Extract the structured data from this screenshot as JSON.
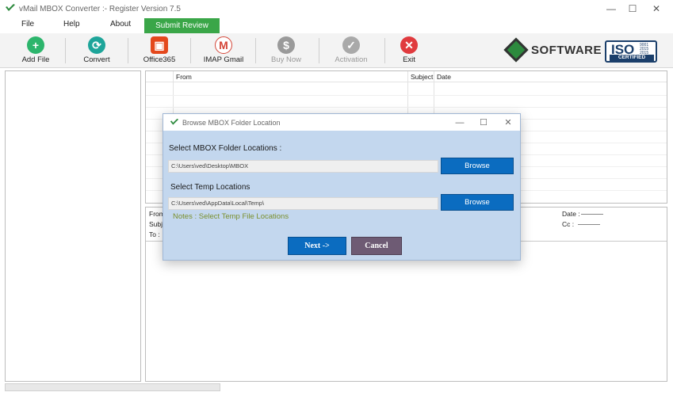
{
  "window": {
    "title": "vMail MBOX Converter :- Register Version 7.5",
    "controls": {
      "minimize": "—",
      "maximize": "☐",
      "close": "✕"
    }
  },
  "menu": {
    "file": "File",
    "help": "Help",
    "about": "About",
    "submit_review": "Submit Review"
  },
  "toolbar": {
    "add_file": {
      "label": "Add File",
      "icon": "plus-circle-icon",
      "color": "#2cb56c"
    },
    "convert": {
      "label": "Convert",
      "icon": "refresh-icon",
      "color": "#1ea59a"
    },
    "office365": {
      "label": "Office365",
      "icon": "office365-icon",
      "color": "#e4481c"
    },
    "imap_gmail": {
      "label": "IMAP Gmail",
      "icon": "gmail-icon",
      "color": "#d44638"
    },
    "buy_now": {
      "label": "Buy Now",
      "icon": "dollar-icon",
      "color": "#9a9a9a"
    },
    "activation": {
      "label": "Activation",
      "icon": "check-circle-icon",
      "color": "#a9a9a9"
    },
    "exit": {
      "label": "Exit",
      "icon": "close-circle-icon",
      "color": "#e03a3e"
    }
  },
  "brand": {
    "software": "SOFTWARE",
    "iso": "ISO",
    "iso_numbers": [
      "9001",
      "2015",
      "2015"
    ],
    "iso_certified": "CERTIFIED"
  },
  "email_list": {
    "columns": [
      "From",
      "Subject",
      "Date"
    ]
  },
  "preview": {
    "from": "From",
    "subject": "Subje",
    "to": "To :",
    "date": "Date :",
    "cc": "Cc :"
  },
  "dialog": {
    "title": "Browse MBOX Folder Location",
    "folder_label": "Select MBOX Folder Locations :",
    "folder_path": "C:\\Users\\ved\\Desktop\\MBOX",
    "browse": "Browse",
    "temp_label": "Select Temp Locations",
    "temp_path": "C:\\Users\\ved\\AppData\\Local\\Temp\\",
    "notes": "Notes : Select Temp File Locations",
    "next": "Next ->",
    "cancel": "Cancel",
    "controls": {
      "minimize": "—",
      "maximize": "☐",
      "close": "✕"
    }
  }
}
